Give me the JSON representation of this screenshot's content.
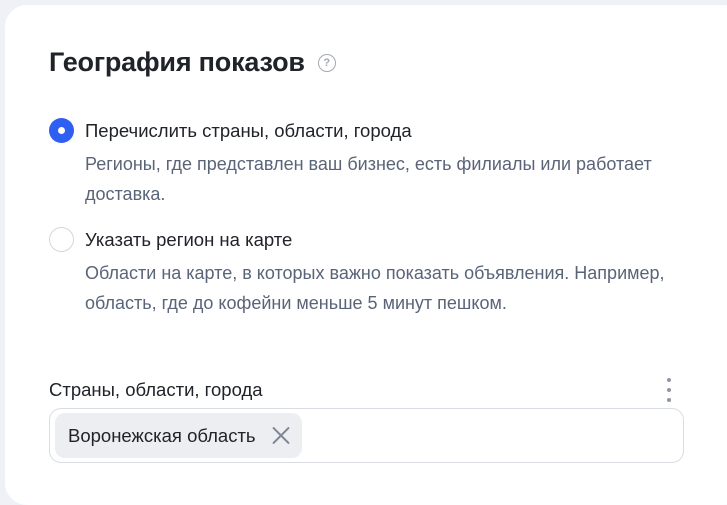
{
  "section": {
    "title": "География показов",
    "help_icon": "?"
  },
  "options": [
    {
      "label": "Перечислить страны, области, города",
      "description": "Регионы, где представлен ваш бизнес, есть филиалы или работает доставка.",
      "selected": true
    },
    {
      "label": "Указать регион на карте",
      "description": "Области на карте, в которых важно показать объявления. Например, область, где до кофейни меньше 5 минут пешком.",
      "selected": false
    }
  ],
  "regions_field": {
    "label": "Страны, области, города",
    "chips": [
      {
        "label": "Воронежская область"
      }
    ]
  },
  "colors": {
    "accent": "#2e5ef2",
    "text_primary": "#20232a",
    "text_secondary": "#5a6478",
    "chip_bg": "#eceef2",
    "page_bg": "#eef1f6"
  }
}
